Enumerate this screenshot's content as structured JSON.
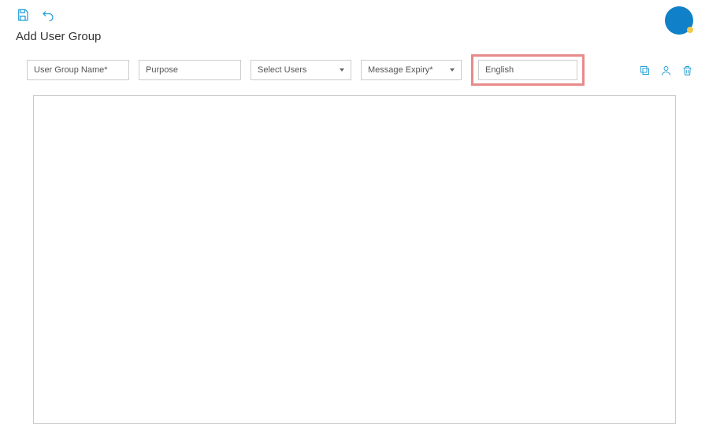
{
  "page": {
    "title": "Add User Group"
  },
  "form": {
    "group_name_placeholder": "User Group Name*",
    "purpose_placeholder": "Purpose",
    "select_users_label": "Select Users",
    "message_expiry_label": "Message Expiry*",
    "language_selected": "English"
  },
  "icons": {
    "save": "save-icon",
    "undo": "undo-icon",
    "copy": "copy-icon",
    "person": "person-icon",
    "trash": "trash-icon"
  }
}
